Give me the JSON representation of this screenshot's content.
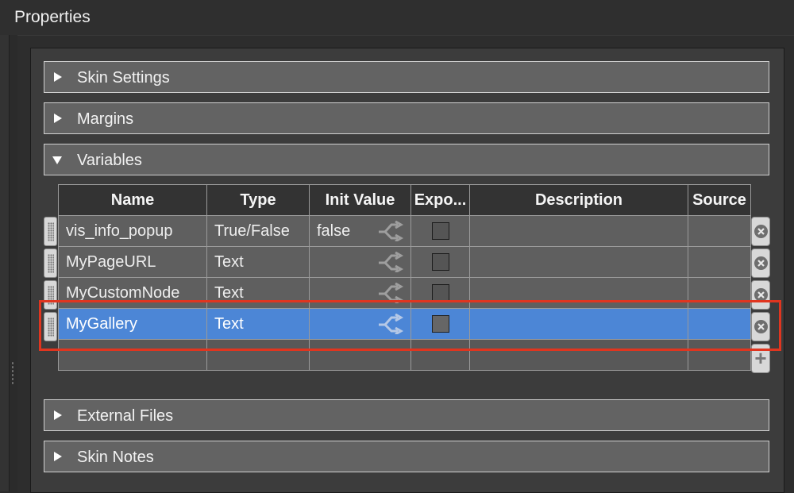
{
  "window": {
    "title": "Properties"
  },
  "sections": {
    "skin_settings": "Skin Settings",
    "margins": "Margins",
    "variables": "Variables",
    "external_files": "External Files",
    "skin_notes": "Skin Notes"
  },
  "variables_table": {
    "headers": {
      "name": "Name",
      "type": "Type",
      "init_value": "Init Value",
      "export": "Expo...",
      "description": "Description",
      "source": "Source"
    },
    "rows": [
      {
        "name": "vis_info_popup",
        "type": "True/False",
        "init_value": "false",
        "export": false,
        "description": "",
        "source": ""
      },
      {
        "name": "MyPageURL",
        "type": "Text",
        "init_value": "",
        "export": false,
        "description": "",
        "source": ""
      },
      {
        "name": "MyCustomNode",
        "type": "Text",
        "init_value": "",
        "export": false,
        "description": "",
        "source": ""
      },
      {
        "name": "MyGallery",
        "type": "Text",
        "init_value": "",
        "export": false,
        "description": "",
        "source": "",
        "selected": true
      }
    ]
  },
  "icons": {
    "share": "share-icon",
    "delete": "close-circle-icon",
    "add": "plus-icon",
    "drag": "drag-handle-icon"
  },
  "colors": {
    "selection": "#4c86d6",
    "highlight_box": "#e0351f",
    "section_bg": "#636363"
  }
}
